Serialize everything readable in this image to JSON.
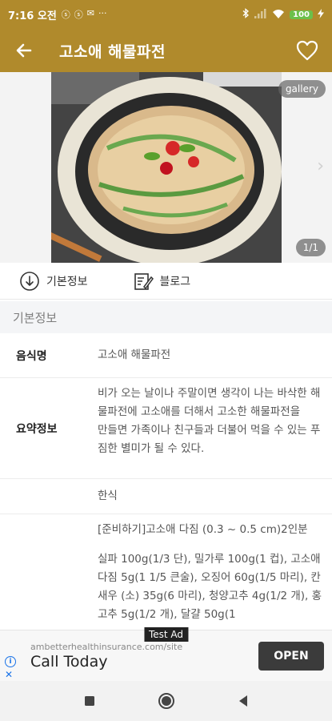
{
  "status_bar": {
    "time": "7:16 오전",
    "battery": "100",
    "notif_icons": [
      "ⓢ",
      "ⓢ",
      "✉",
      "···"
    ]
  },
  "app_bar": {
    "title": "고소애 해물파전"
  },
  "image": {
    "gallery_label": "gallery",
    "counter": "1/1"
  },
  "tabs": [
    {
      "label": "기본정보",
      "icon": "info-download-icon"
    },
    {
      "label": "블로그",
      "icon": "blog-edit-icon"
    }
  ],
  "section": {
    "title": "기본정보"
  },
  "info": {
    "name_label": "음식명",
    "name_value": "고소애 해물파전",
    "summary_label": "요약정보",
    "summary_line1": "비가 오는 날이나 주말이면 생각이 나는 바삭한 해물파전에 고소애를 더해서 고소한 해물파전을",
    "summary_line2": "만들면 가족이나 친구들과 더불어 먹을 수 있는 푸짐한 별미가 될 수 있다.",
    "category_value": "한식",
    "recipe_line1": "[준비하기]고소애 다짐 (0.3 ~ 0.5 cm)2인분",
    "recipe_line2": "실파 100g(1/3 단), 밀가루 100g(1 컵), 고소애 다짐 5g(1 1/5 큰술), 오징어 60g(1/5 마리), 칸새우 (소) 35g(6 마리), 청양고추 4g(1/2 개), 홍고추 5g(1/2 개), 달걀 50g(1"
  },
  "ad": {
    "tag": "Test Ad",
    "url": "ambetterhealthinsurance.com/site",
    "title": "Call Today",
    "open_label": "OPEN"
  },
  "colors": {
    "accent": "#b08a2c",
    "section_bg": "#f4f5f7"
  }
}
